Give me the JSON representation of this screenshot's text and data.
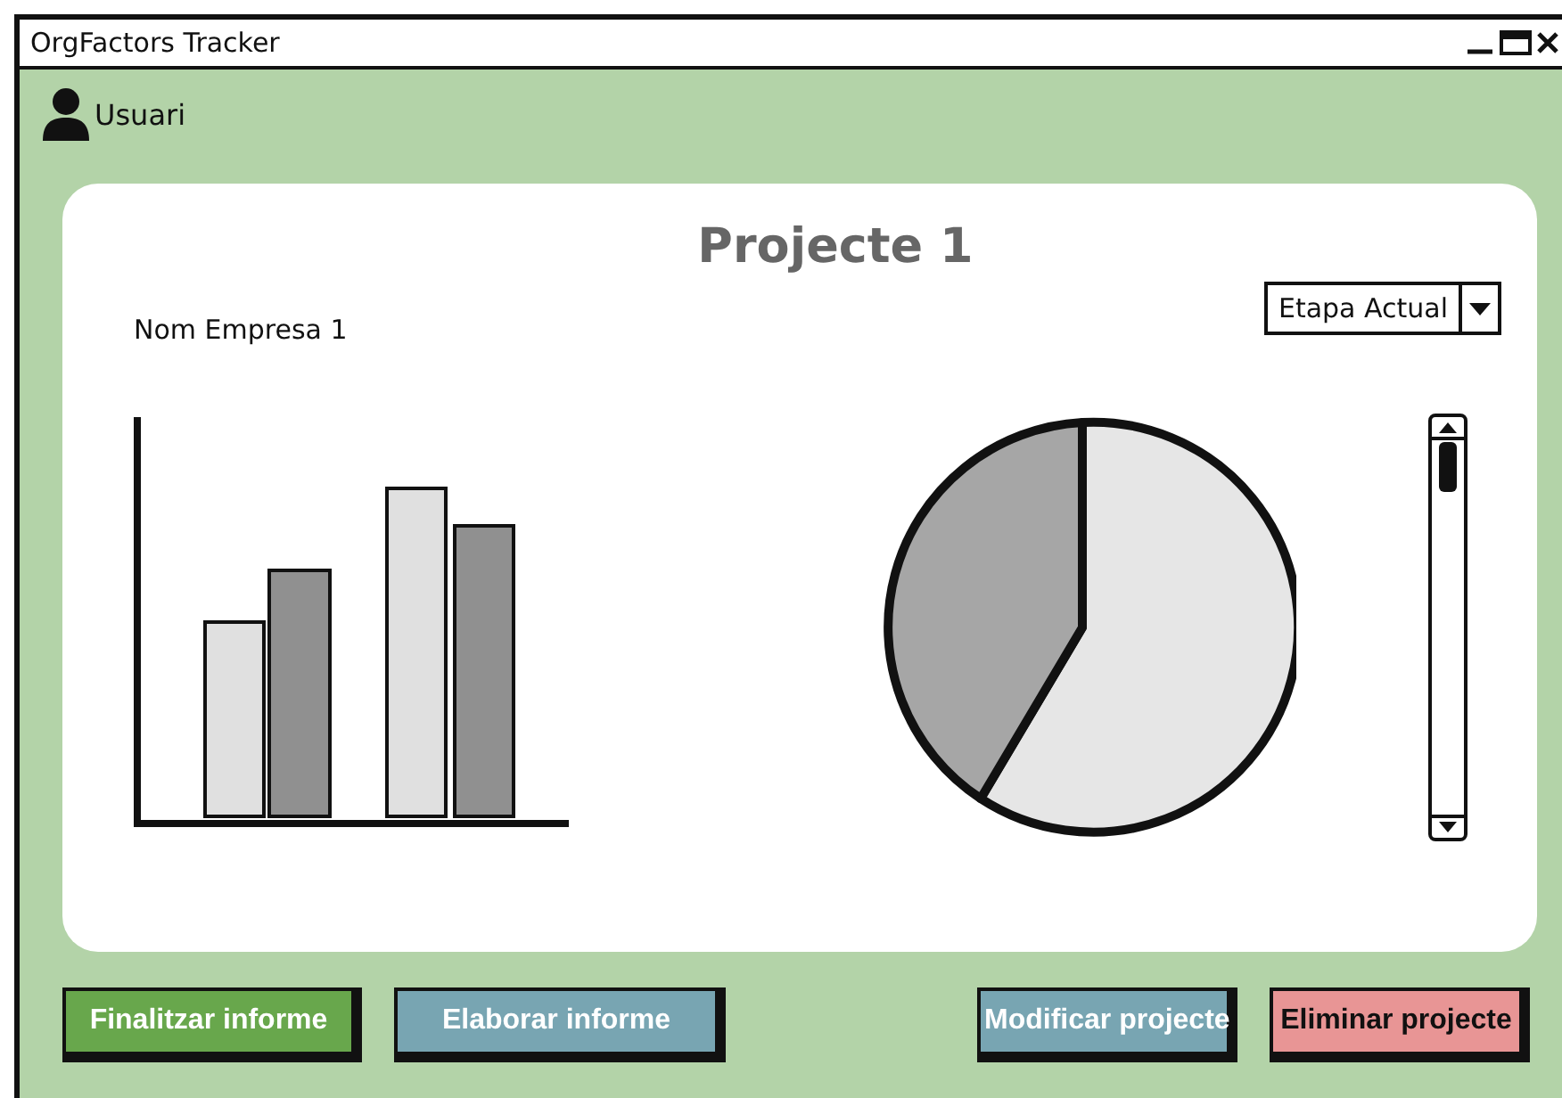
{
  "window": {
    "title": "OrgFactors Tracker"
  },
  "user": {
    "label": "Usuari"
  },
  "project": {
    "title": "Projecte 1",
    "company": "Nom Empresa 1",
    "stage_dropdown": {
      "value": "Etapa Actual"
    }
  },
  "buttons": [
    {
      "label": "Finalitzar informe",
      "color": "#68a74c"
    },
    {
      "label": "Elaborar informe",
      "color": "#78a5b2"
    },
    {
      "label": "Modificar projecte",
      "color": "#78a5b2"
    },
    {
      "label": "Eliminar projecte",
      "color": "#e89595"
    }
  ]
}
